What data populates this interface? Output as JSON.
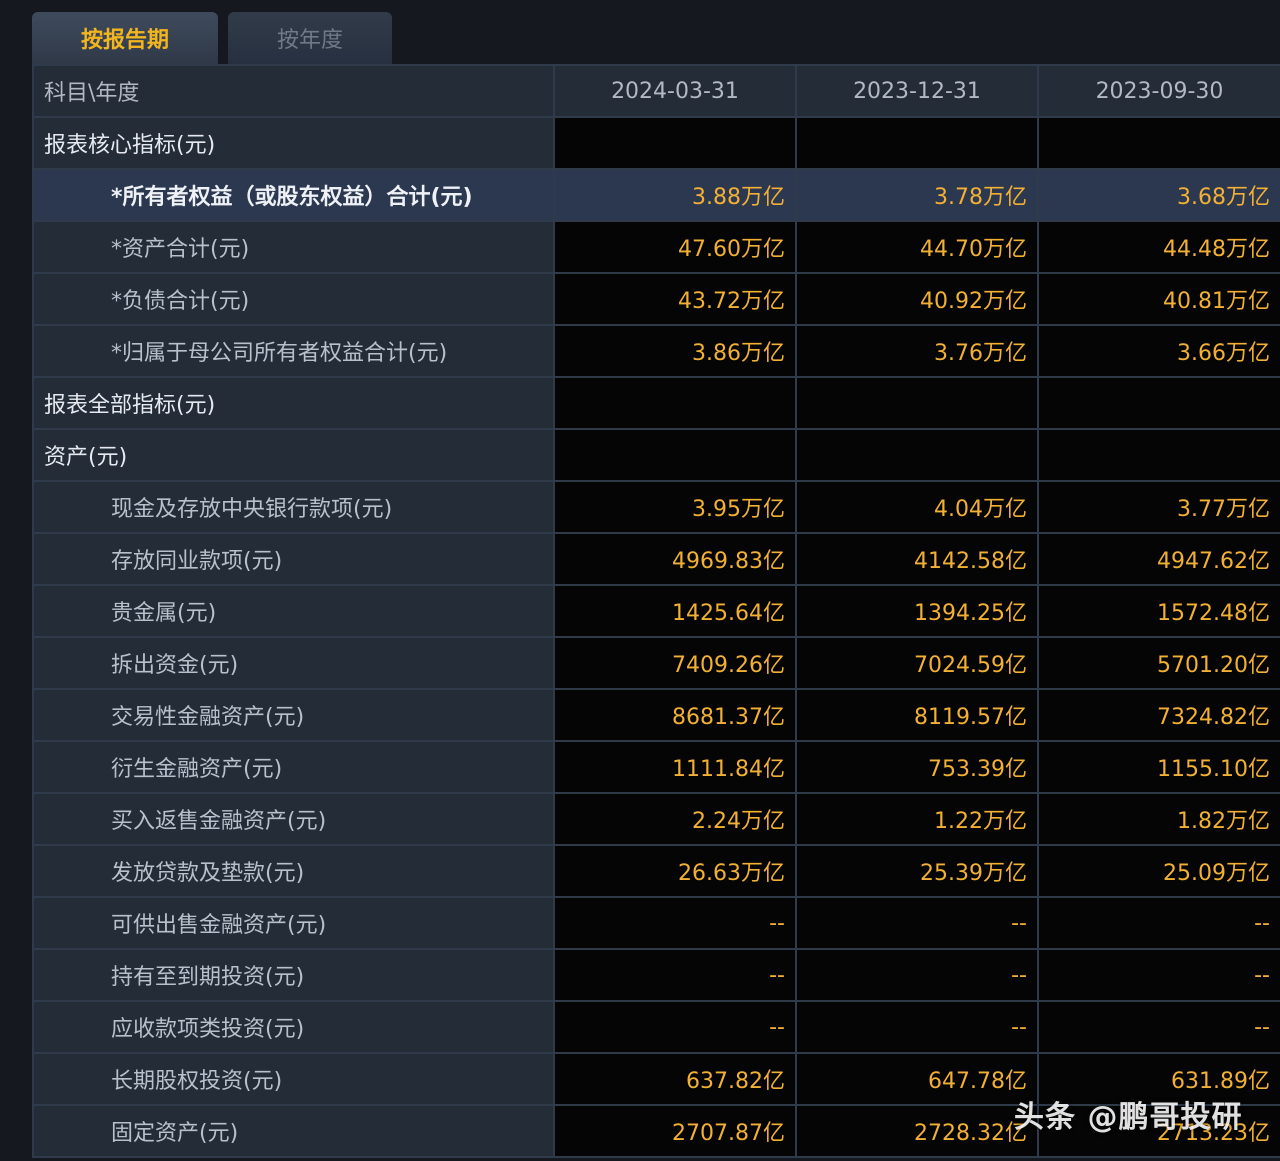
{
  "tabs": [
    {
      "label": "按报告期",
      "active": true
    },
    {
      "label": "按年度",
      "active": false
    }
  ],
  "table": {
    "header": [
      "科目\\年度",
      "2024-03-31",
      "2023-12-31",
      "2023-09-30"
    ],
    "rows": [
      {
        "label": "报表核心指标(元)",
        "type": "section",
        "values": [
          "",
          "",
          ""
        ]
      },
      {
        "label": "*所有者权益（或股东权益）合计(元)",
        "type": "highlight",
        "values": [
          "3.88万亿",
          "3.78万亿",
          "3.68万亿"
        ]
      },
      {
        "label": "*资产合计(元)",
        "type": "item",
        "values": [
          "47.60万亿",
          "44.70万亿",
          "44.48万亿"
        ]
      },
      {
        "label": "*负债合计(元)",
        "type": "item",
        "values": [
          "43.72万亿",
          "40.92万亿",
          "40.81万亿"
        ]
      },
      {
        "label": "*归属于母公司所有者权益合计(元)",
        "type": "item",
        "values": [
          "3.86万亿",
          "3.76万亿",
          "3.66万亿"
        ]
      },
      {
        "label": "报表全部指标(元)",
        "type": "section",
        "values": [
          "",
          "",
          ""
        ]
      },
      {
        "label": "资产(元)",
        "type": "section",
        "values": [
          "",
          "",
          ""
        ]
      },
      {
        "label": "现金及存放中央银行款项(元)",
        "type": "item",
        "values": [
          "3.95万亿",
          "4.04万亿",
          "3.77万亿"
        ]
      },
      {
        "label": "存放同业款项(元)",
        "type": "item",
        "values": [
          "4969.83亿",
          "4142.58亿",
          "4947.62亿"
        ]
      },
      {
        "label": "贵金属(元)",
        "type": "item",
        "values": [
          "1425.64亿",
          "1394.25亿",
          "1572.48亿"
        ]
      },
      {
        "label": "拆出资金(元)",
        "type": "item",
        "values": [
          "7409.26亿",
          "7024.59亿",
          "5701.20亿"
        ]
      },
      {
        "label": "交易性金融资产(元)",
        "type": "item",
        "values": [
          "8681.37亿",
          "8119.57亿",
          "7324.82亿"
        ]
      },
      {
        "label": "衍生金融资产(元)",
        "type": "item",
        "values": [
          "1111.84亿",
          "753.39亿",
          "1155.10亿"
        ]
      },
      {
        "label": "买入返售金融资产(元)",
        "type": "item",
        "values": [
          "2.24万亿",
          "1.22万亿",
          "1.82万亿"
        ]
      },
      {
        "label": "发放贷款及垫款(元)",
        "type": "item",
        "values": [
          "26.63万亿",
          "25.39万亿",
          "25.09万亿"
        ]
      },
      {
        "label": "可供出售金融资产(元)",
        "type": "item",
        "values": [
          "--",
          "--",
          "--"
        ]
      },
      {
        "label": "持有至到期投资(元)",
        "type": "item",
        "values": [
          "--",
          "--",
          "--"
        ]
      },
      {
        "label": "应收款项类投资(元)",
        "type": "item",
        "values": [
          "--",
          "--",
          "--"
        ]
      },
      {
        "label": "长期股权投资(元)",
        "type": "item",
        "values": [
          "637.82亿",
          "647.78亿",
          "631.89亿"
        ]
      },
      {
        "label": "固定资产(元)",
        "type": "item",
        "values": [
          "2707.87亿",
          "2728.32亿",
          "2713.23亿"
        ]
      }
    ]
  },
  "watermark": "头条 @鹏哥投研",
  "colors": {
    "accent": "#f2b034",
    "tab_active_text": "#f2b51f",
    "background": "#15181f"
  }
}
